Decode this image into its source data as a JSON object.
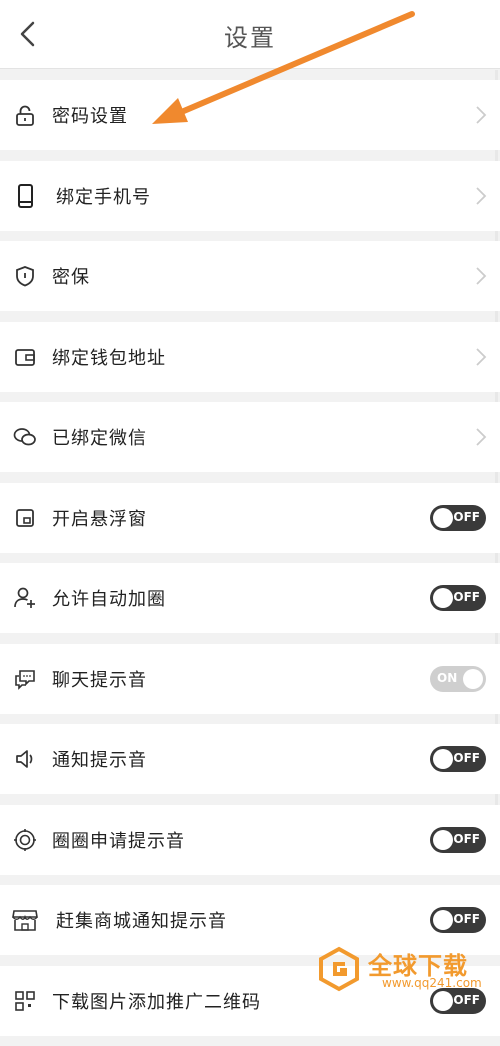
{
  "header": {
    "title": "设置"
  },
  "rows": [
    {
      "label": "密码设置",
      "icon": "lock-icon",
      "control": "chevron"
    },
    {
      "label": "绑定手机号",
      "icon": "phone-icon",
      "control": "chevron"
    },
    {
      "label": "密保",
      "icon": "shield-icon",
      "control": "chevron"
    },
    {
      "label": "绑定钱包地址",
      "icon": "wallet-icon",
      "control": "chevron"
    },
    {
      "label": "已绑定微信",
      "icon": "wechat-icon",
      "control": "chevron"
    },
    {
      "label": "开启悬浮窗",
      "icon": "floating-window-icon",
      "control": "toggle",
      "toggle_text": "OFF",
      "state": "off"
    },
    {
      "label": "允许自动加圈",
      "icon": "add-user-icon",
      "control": "toggle",
      "toggle_text": "OFF",
      "state": "off"
    },
    {
      "label": "聊天提示音",
      "icon": "chat-icon",
      "control": "toggle",
      "toggle_text": "ON",
      "state": "on"
    },
    {
      "label": "通知提示音",
      "icon": "speaker-icon",
      "control": "toggle",
      "toggle_text": "OFF",
      "state": "off"
    },
    {
      "label": "圈圈申请提示音",
      "icon": "target-icon",
      "control": "toggle",
      "toggle_text": "OFF",
      "state": "off"
    },
    {
      "label": "赶集商城通知提示音",
      "icon": "store-icon",
      "control": "toggle",
      "toggle_text": "OFF",
      "state": "off"
    },
    {
      "label": "下载图片添加推广二维码",
      "icon": "qr-code-icon",
      "control": "toggle",
      "toggle_text": "OFF",
      "state": "off"
    }
  ],
  "watermark": {
    "text": "全球下载",
    "url": "www.qq241.com",
    "icon": "watermark-logo-icon"
  },
  "colors": {
    "annotation_arrow": "#f0892e",
    "toggle_off": "#3a3a3a",
    "toggle_on": "#cfcfcf"
  }
}
